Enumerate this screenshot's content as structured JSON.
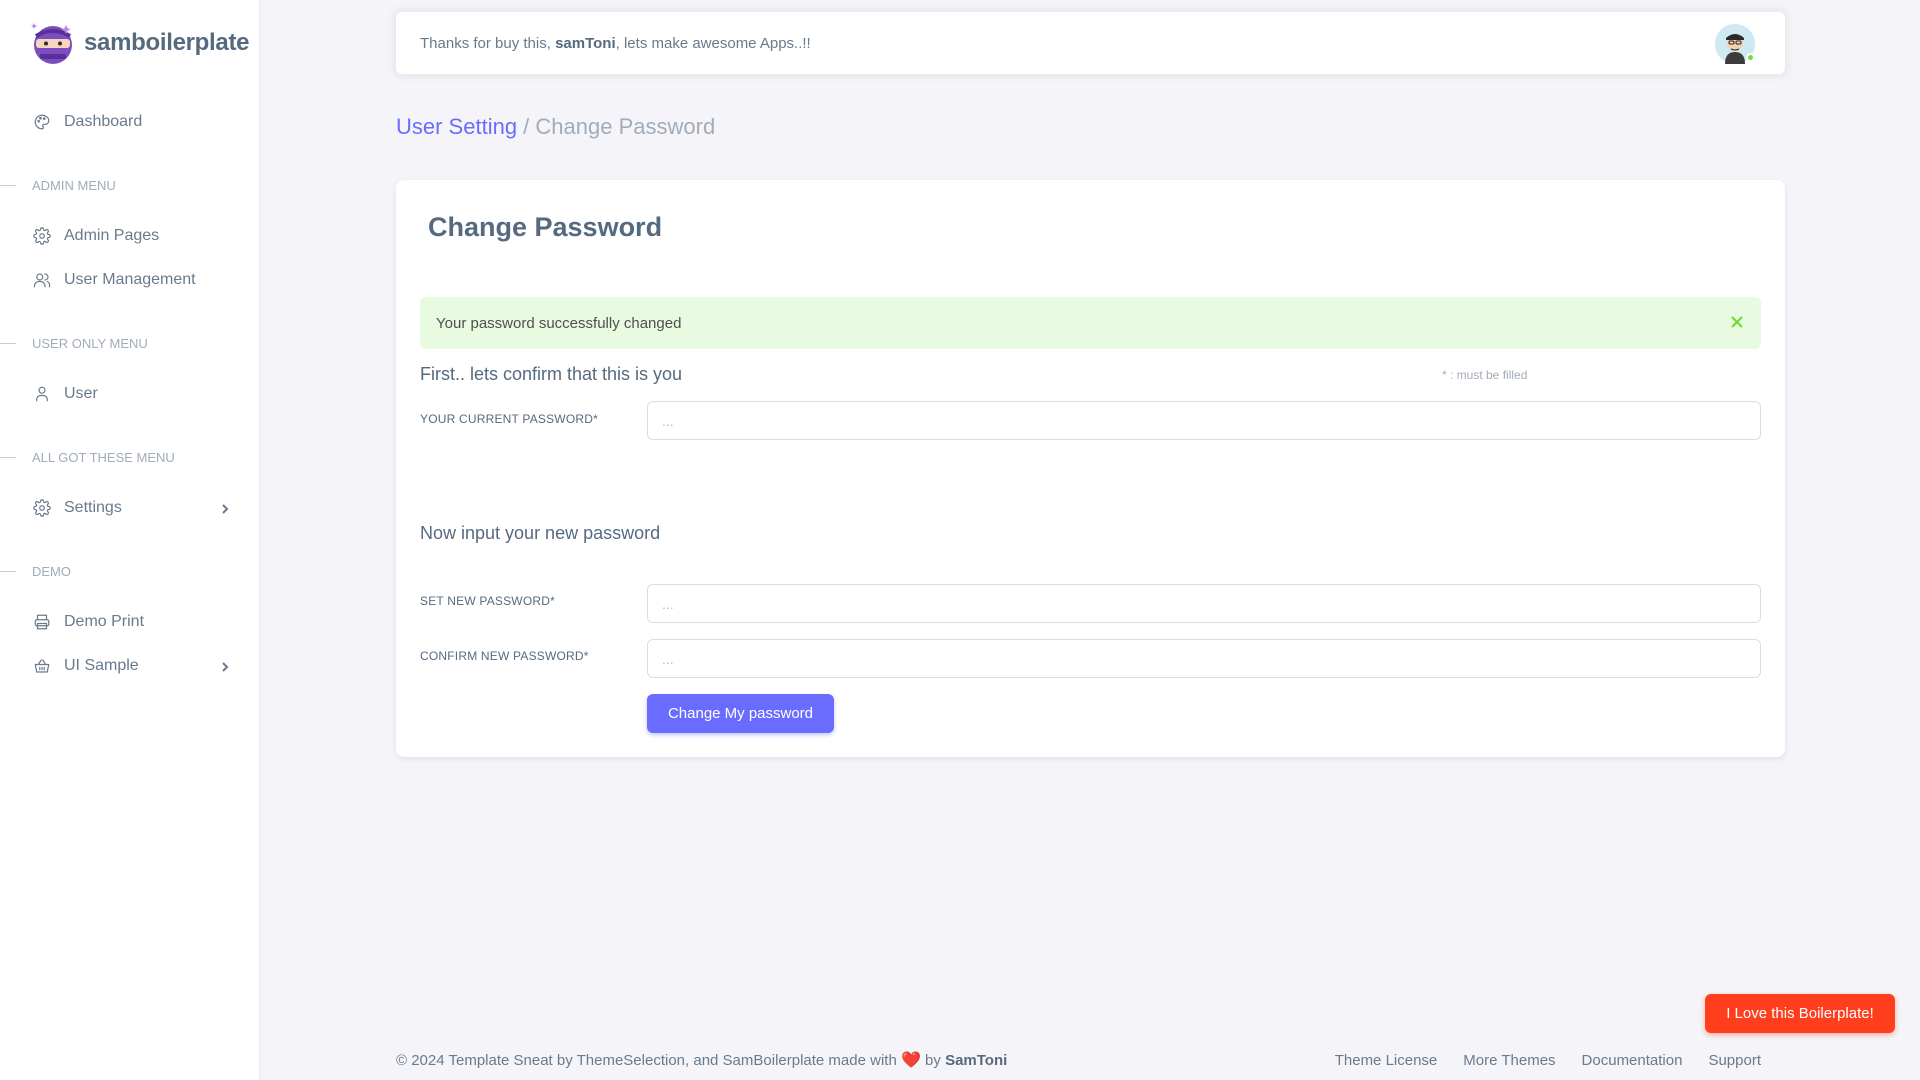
{
  "brand": {
    "name": "samboilerplate",
    "logo_icon": "ninja-logo-icon"
  },
  "sidebar": {
    "dashboard": {
      "label": "Dashboard",
      "icon": "palette-icon"
    },
    "sections": [
      {
        "header": "ADMIN MENU",
        "items": [
          {
            "label": "Admin Pages",
            "icon": "gear-icon"
          },
          {
            "label": "User Management",
            "icon": "users-icon"
          }
        ]
      },
      {
        "header": "USER ONLY MENU",
        "items": [
          {
            "label": "User",
            "icon": "user-icon"
          }
        ]
      },
      {
        "header": "ALL GOT THESE MENU",
        "items": [
          {
            "label": "Settings",
            "icon": "gear-icon",
            "has_submenu": true
          }
        ]
      },
      {
        "header": "DEMO",
        "items": [
          {
            "label": "Demo Print",
            "icon": "printer-icon"
          },
          {
            "label": "UI Sample",
            "icon": "basket-icon",
            "has_submenu": true
          }
        ]
      }
    ]
  },
  "navbar": {
    "message_prefix": "Thanks for buy this, ",
    "username": "samToni",
    "message_suffix": ", lets make awesome Apps..!!"
  },
  "breadcrumb": {
    "parent": "User Setting",
    "separator": " / ",
    "current": "Change Password"
  },
  "card": {
    "title": "Change Password",
    "alert": {
      "text": "Your password successfully changed",
      "close_icon": "close-icon"
    },
    "confirm_section": {
      "title": "First.. lets confirm that this is you",
      "required_note": "* : must be filled",
      "current_password_label": "YOUR CURRENT PASSWORD*",
      "current_password_placeholder": "..."
    },
    "new_section": {
      "title": "Now input your new password",
      "new_password_label": "SET NEW PASSWORD*",
      "new_password_placeholder": "...",
      "confirm_password_label": "CONFIRM NEW PASSWORD*",
      "confirm_password_placeholder": "..."
    },
    "submit_label": "Change My password"
  },
  "footer": {
    "copyright_prefix": "© 2024 Template Sneat by ThemeSelection, and SamBoilerplate made with ",
    "heart": "❤️",
    "by": " by ",
    "author": "SamToni",
    "links": [
      "Theme License",
      "More Themes",
      "Documentation",
      "Support"
    ]
  },
  "floating_button": "I Love this Boilerplate!",
  "colors": {
    "primary": "#696cff",
    "danger": "#ff3e1d",
    "success": "#71dd37"
  }
}
